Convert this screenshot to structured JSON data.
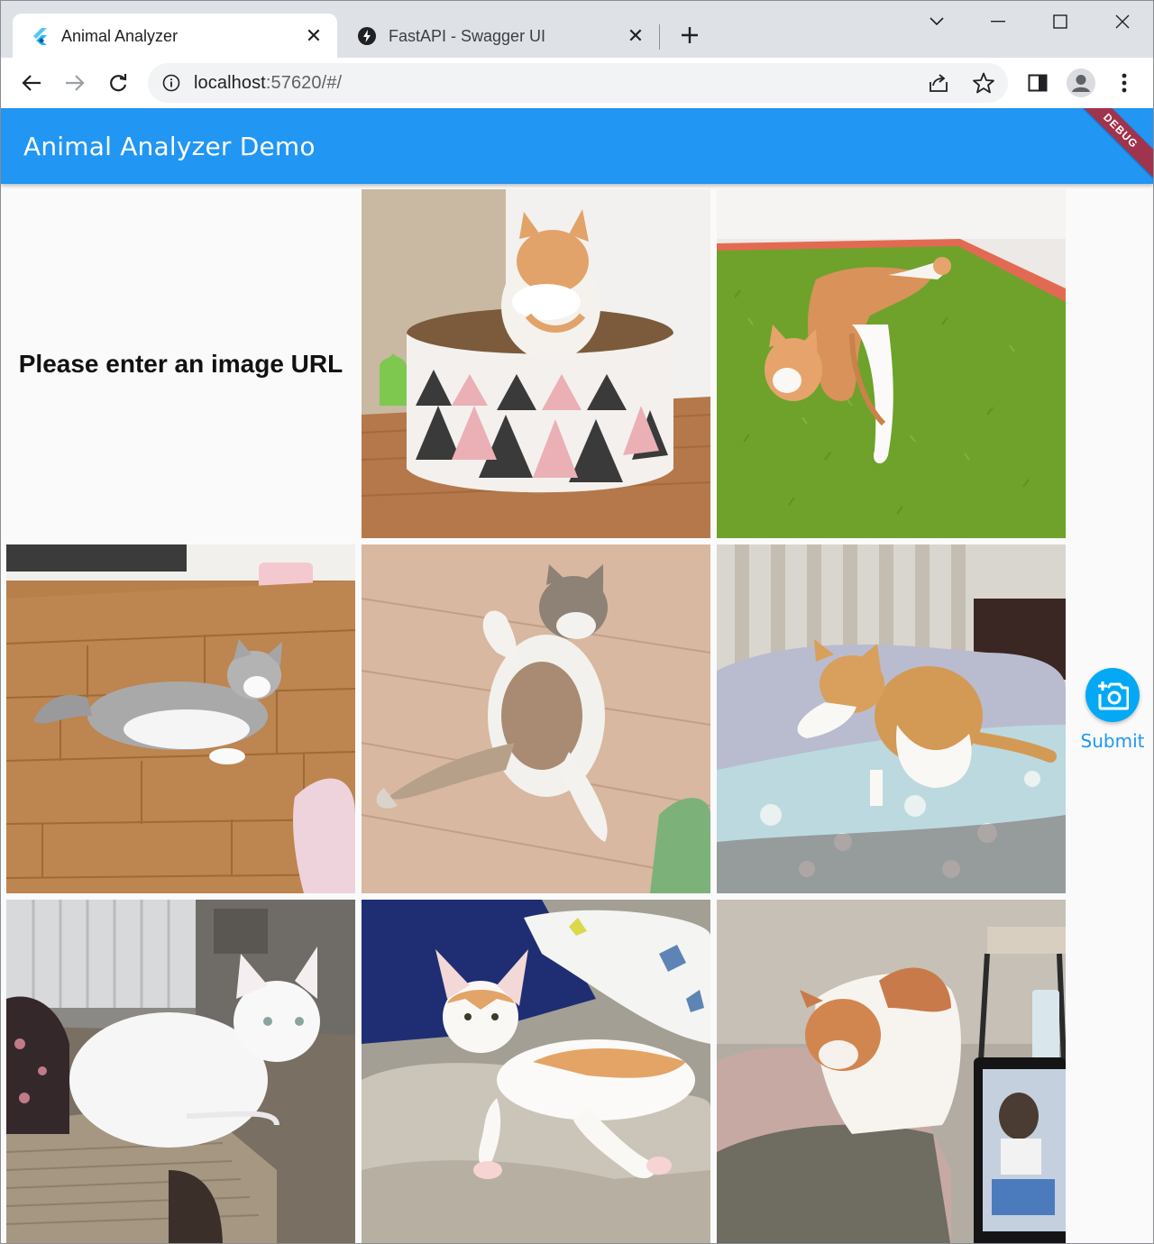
{
  "browser": {
    "tabs": [
      {
        "title": "Animal Analyzer",
        "favicon": "flutter-icon",
        "active": true
      },
      {
        "title": "FastAPI - Swagger UI",
        "favicon": "fastapi-bolt-icon",
        "active": false
      }
    ],
    "address": {
      "host": "localhost",
      "rest": ":57620/#/"
    }
  },
  "app": {
    "title": "Animal Analyzer Demo",
    "debug_banner": "DEBUG",
    "prompt": "Please enter an image URL",
    "submit_label": "Submit",
    "submit_icon": "add-a-photo-icon",
    "accent_color": "#2196f3"
  },
  "gallery": [
    {
      "alt": "Orange and white cat grooming inside a round cardboard scratcher box with triangle pattern"
    },
    {
      "alt": "Orange and white cat lying stretched on green artificial grass mat"
    },
    {
      "alt": "Grey and white cat lying on wooden floor"
    },
    {
      "alt": "Fluffy grey and white cat grooming its leg on wooden floor"
    },
    {
      "alt": "Orange and white cat grooming on a bed with blue floral sheet"
    },
    {
      "alt": "White cat loafing on a cardboard scratcher lounge"
    },
    {
      "alt": "Orange and white kitten lying on a sofa cushion"
    },
    {
      "alt": "Orange and white cat standing on a bed near a laptop"
    }
  ]
}
